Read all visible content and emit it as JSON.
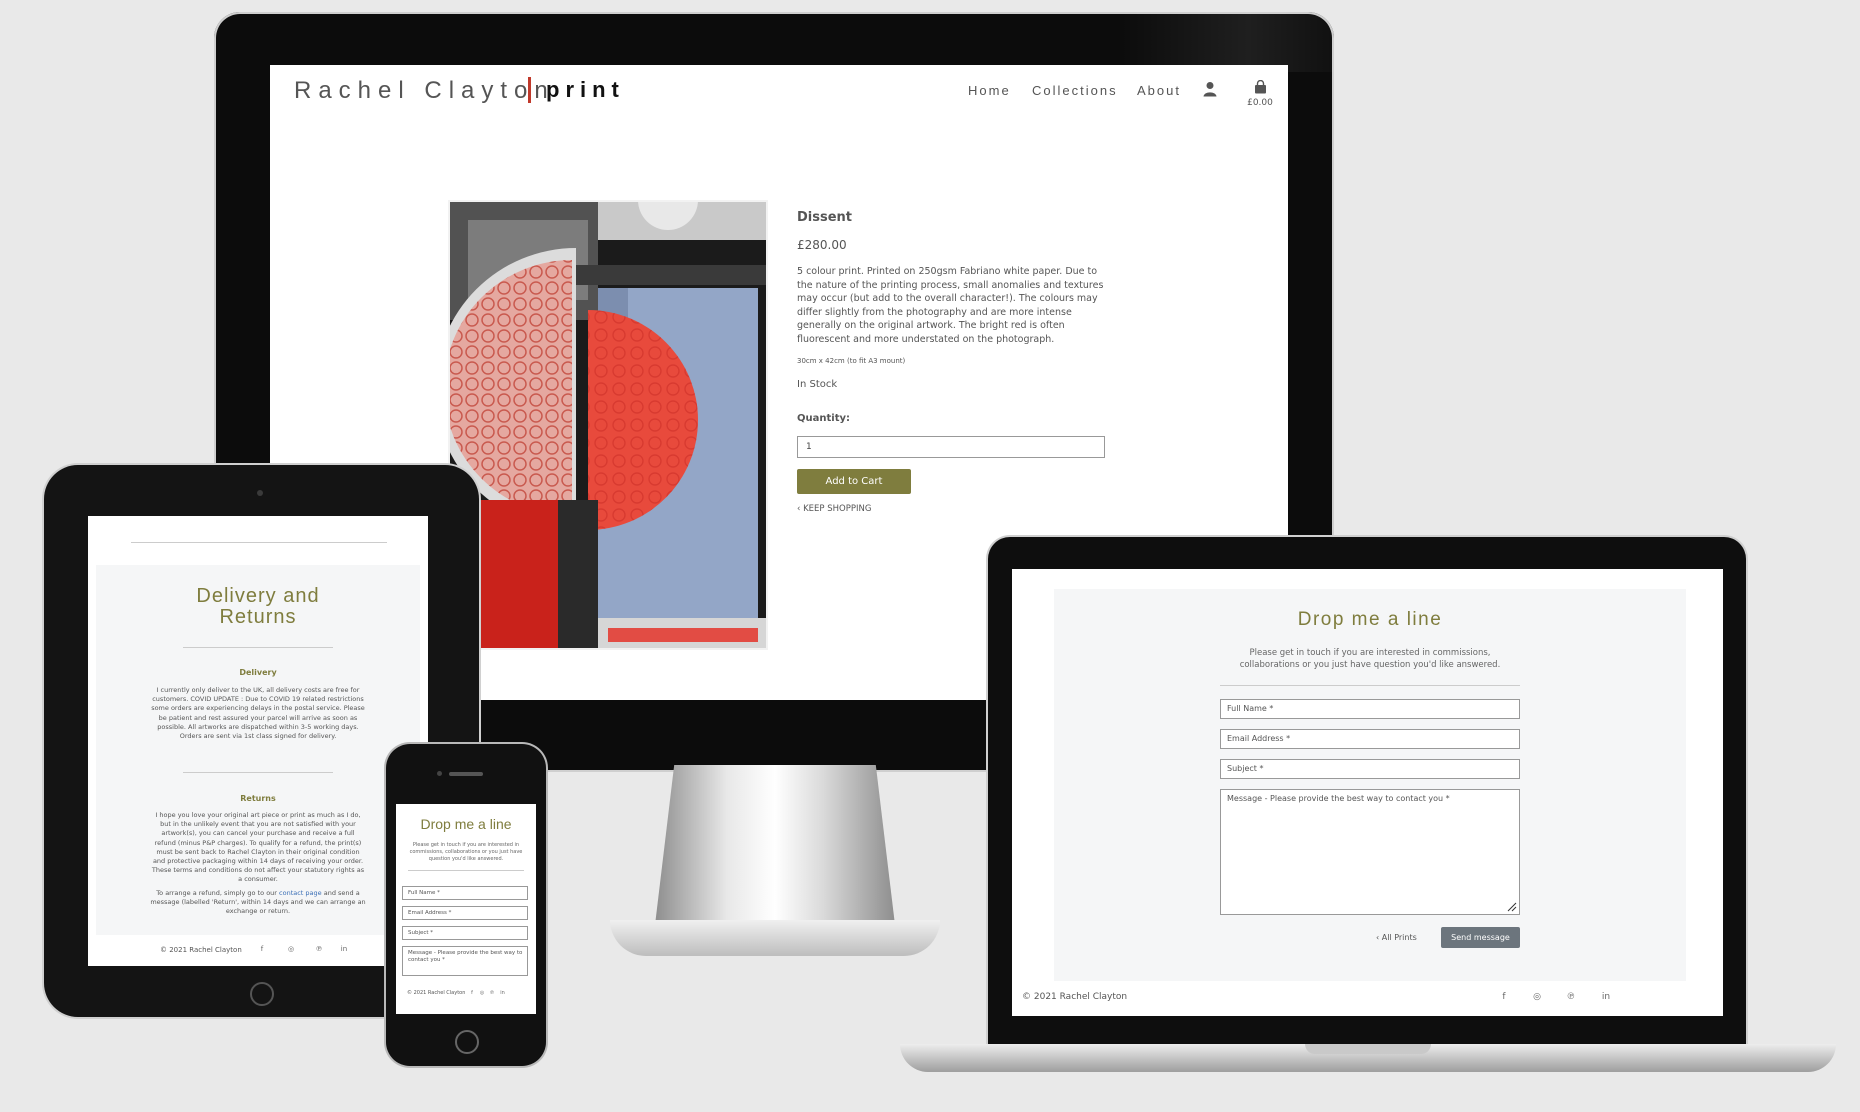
{
  "colors": {
    "accent": "#7f7d3e",
    "brand_bar": "#c0392b",
    "send_button": "#6c757d",
    "link": "#3b6fb6"
  },
  "desktop": {
    "brand_name": "Rachel Clayton",
    "brand_suffix": "print",
    "nav": {
      "home": "Home",
      "collections": "Collections",
      "about": "About",
      "cart_total": "£0.00"
    },
    "icons": {
      "account": "user-icon",
      "cart": "shopping-bag-icon",
      "back": "chevron-left-icon"
    },
    "product": {
      "title": "Dissent",
      "price": "£280.00",
      "description": "5 colour print. Printed on 250gsm Fabriano white paper. Due to the nature of the printing process, small anomalies and textures may occur (but add to the overall character!). The colours may differ slightly from the photography and are more intense generally on the original artwork. The bright red is often fluorescent and more understated on the photograph.",
      "size": "30cm x 42cm (to fit A3 mount)",
      "stock": "In Stock",
      "quantity_label": "Quantity:",
      "quantity_value": "1",
      "add_to_cart": "Add to Cart",
      "keep_shopping": "KEEP SHOPPING"
    }
  },
  "tablet": {
    "title": "Delivery and Returns",
    "delivery_heading": "Delivery",
    "delivery_text": "I currently only deliver to the UK, all delivery costs are free for customers. COVID UPDATE : Due to COVID 19 related restrictions some orders are experiencing delays in the postal service. Please be patient and rest assured your parcel will arrive as soon as possible. All artworks are dispatched within 3-5 working days. Orders are sent via 1st class signed for delivery.",
    "returns_heading": "Returns",
    "returns_text": "I hope you love your original art piece or print as much as I do, but in the unlikely event that you are not satisfied with your artwork(s), you can cancel your purchase and receive a full refund (minus P&P charges). To qualify for a refund, the print(s) must be sent back to Rachel Clayton in their original condition and protective packaging within 14 days of receiving your order. These terms and conditions do not affect your statutory rights as a consumer.",
    "refund_prefix": "To arrange a refund, simply go to our ",
    "refund_link": "contact page",
    "refund_suffix": " and send a message (labelled 'Return', within 14 days and we can arrange an exchange or return.",
    "copyright": "© 2021 Rachel Clayton",
    "social": {
      "facebook": "f",
      "instagram": "◎",
      "pinterest": "℗",
      "linkedin": "in"
    }
  },
  "phone": {
    "title": "Drop me a line",
    "subtitle": "Please get in touch if you are interested in commissions, collaborations or you just have question you'd like answered.",
    "full_name_placeholder": "Full Name *",
    "email_placeholder": "Email Address *",
    "subject_placeholder": "Subject *",
    "message_placeholder": "Message - Please provide the best way to contact you *",
    "copyright": "© 2021 Rachel Clayton",
    "social": {
      "facebook": "f",
      "instagram": "◎",
      "pinterest": "℗",
      "linkedin": "in"
    }
  },
  "laptop": {
    "title": "Drop me a line",
    "subtitle": "Please get in touch if you are interested in commissions, collaborations or you just have question you'd like answered.",
    "full_name_placeholder": "Full Name *",
    "email_placeholder": "Email Address *",
    "subject_placeholder": "Subject *",
    "message_placeholder": "Message - Please provide the best way to contact you *",
    "all_prints": "All Prints",
    "send": "Send message",
    "copyright": "© 2021 Rachel Clayton",
    "social": {
      "facebook": "f",
      "instagram": "◎",
      "pinterest": "℗",
      "linkedin": "in"
    }
  }
}
